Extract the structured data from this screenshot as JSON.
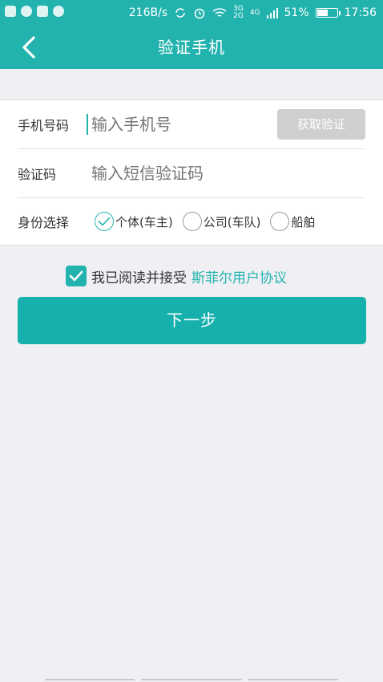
{
  "status_bar": {
    "speed": "216B/s",
    "network_small_top": "3G",
    "network_small_bottom": "2G",
    "lte": "4G",
    "battery": "51%",
    "time": "17:56",
    "icons": [
      "app-icon",
      "wechat-icon",
      "notification-icon",
      "browser-icon",
      "sync-icon",
      "alarm-icon",
      "wifi-icon",
      "signal-icon"
    ]
  },
  "app_bar": {
    "title": "验证手机",
    "back_icon": "chevron-left-icon"
  },
  "form": {
    "phone": {
      "label": "手机号码",
      "placeholder": "输入手机号",
      "button": "获取验证"
    },
    "code": {
      "label": "验证码",
      "placeholder": "输入短信验证码"
    },
    "identity": {
      "label": "身份选择",
      "options": [
        {
          "label": "个体(车主)",
          "checked": true
        },
        {
          "label": "公司(车队)",
          "checked": false
        },
        {
          "label": "船舶",
          "checked": false
        }
      ]
    }
  },
  "agreement": {
    "checked": true,
    "text": "我已阅读并接受",
    "link": "斯菲尔用户协议"
  },
  "next_button": "下一步",
  "colors": {
    "primary": "#23b3ae",
    "button": "#17b1ad",
    "background": "#f0eff4",
    "disabled_button": "#cfcfcf"
  }
}
